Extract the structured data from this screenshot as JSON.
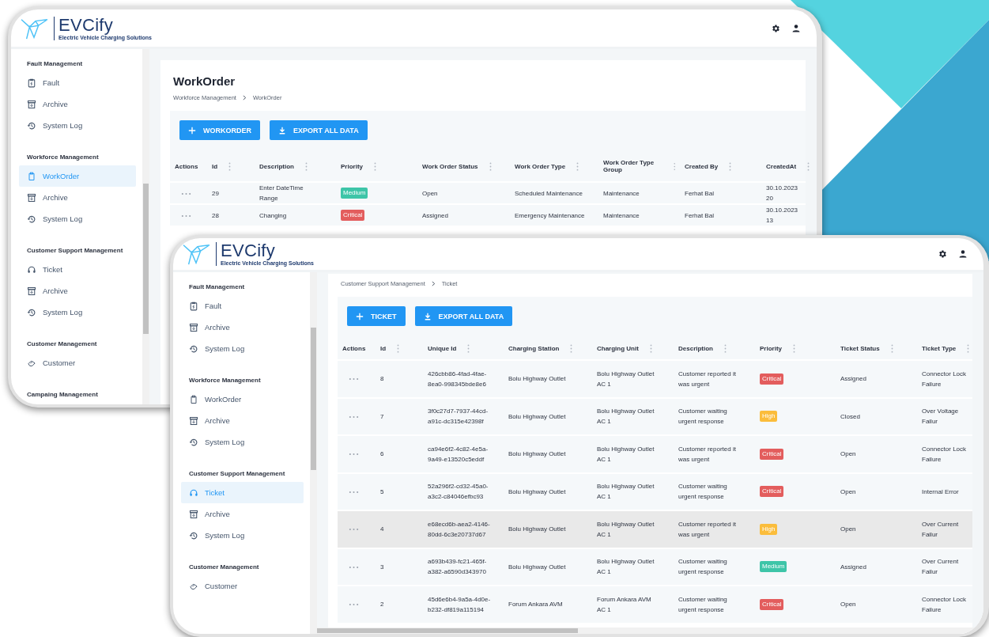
{
  "windows": [
    {
      "logo": {
        "name": "EVCify",
        "tagline": "Electric Vehicle Charging Solutions"
      },
      "sidebar": {
        "sections": [
          {
            "heading": "Fault Management",
            "items": [
              {
                "label": "Fault",
                "kind": "fault",
                "selected": false
              },
              {
                "label": "Archive",
                "kind": "archive",
                "selected": false
              },
              {
                "label": "System Log",
                "kind": "log",
                "selected": false
              }
            ]
          },
          {
            "heading": "Workforce Management",
            "items": [
              {
                "label": "WorkOrder",
                "kind": "workorder",
                "selected": true
              },
              {
                "label": "Archive",
                "kind": "archive",
                "selected": false
              },
              {
                "label": "System Log",
                "kind": "log",
                "selected": false
              }
            ]
          },
          {
            "heading": "Customer Support Management",
            "items": [
              {
                "label": "Ticket",
                "kind": "ticket",
                "selected": false
              },
              {
                "label": "Archive",
                "kind": "archive",
                "selected": false
              },
              {
                "label": "System Log",
                "kind": "log",
                "selected": false
              }
            ]
          },
          {
            "heading": "Customer Management",
            "items": [
              {
                "label": "Customer",
                "kind": "customer",
                "selected": false
              }
            ]
          },
          {
            "heading": "Campaing Management"
          }
        ]
      },
      "page_title": "WorkOrder",
      "breadcrumb": [
        "Workforce Management",
        "WorkOrder"
      ],
      "buttons": [
        {
          "label": "WORKORDER",
          "kind": "add"
        },
        {
          "label": "EXPORT ALL DATA",
          "kind": "export"
        }
      ],
      "table": {
        "columns": [
          {
            "label": "Actions",
            "kind": "actions"
          },
          {
            "label": "Id",
            "kind": "text"
          },
          {
            "label": "Description",
            "kind": "text"
          },
          {
            "label": "Priority",
            "kind": "badge"
          },
          {
            "label": "Work Order Status",
            "kind": "text"
          },
          {
            "label": "Work Order Type",
            "kind": "text"
          },
          {
            "label": "Work Order Type Group",
            "kind": "text"
          },
          {
            "label": "Created By",
            "kind": "text"
          },
          {
            "label": "CreatedAt",
            "kind": "text"
          }
        ],
        "rows": [
          {
            "selected": false,
            "cells": [
              "",
              "29",
              "Enter DateTime Range",
              {
                "label": "Medium",
                "color": "#3ec5a8"
              },
              "Open",
              "Scheduled Maintenance",
              "Maintenance",
              "Ferhat Bal",
              "30.10.2023 20"
            ]
          },
          {
            "selected": false,
            "cells": [
              "",
              "28",
              "Changing",
              {
                "label": "Critical",
                "color": "#e35d5d"
              },
              "Assigned",
              "Emergency Maintenance",
              "Maintenance",
              "Ferhat Bal",
              "30.10.2023 13"
            ]
          }
        ]
      }
    },
    {
      "logo": {
        "name": "EVCify",
        "tagline": "Electric Vehicle Charging Solutions"
      },
      "sidebar": {
        "sections": [
          {
            "heading": "Fault Management",
            "items": [
              {
                "label": "Fault",
                "kind": "fault",
                "selected": false
              },
              {
                "label": "Archive",
                "kind": "archive",
                "selected": false
              },
              {
                "label": "System Log",
                "kind": "log",
                "selected": false
              }
            ]
          },
          {
            "heading": "Workforce Management",
            "items": [
              {
                "label": "WorkOrder",
                "kind": "workorder",
                "selected": false
              },
              {
                "label": "Archive",
                "kind": "archive",
                "selected": false
              },
              {
                "label": "System Log",
                "kind": "log",
                "selected": false
              }
            ]
          },
          {
            "heading": "Customer Support Management",
            "items": [
              {
                "label": "Ticket",
                "kind": "ticket",
                "selected": true
              },
              {
                "label": "Archive",
                "kind": "archive",
                "selected": false
              },
              {
                "label": "System Log",
                "kind": "log",
                "selected": false
              }
            ]
          },
          {
            "heading": "Customer Management",
            "items": [
              {
                "label": "Customer",
                "kind": "customer",
                "selected": false
              }
            ]
          }
        ]
      },
      "breadcrumb": [
        "Customer Support Management",
        "Ticket"
      ],
      "buttons": [
        {
          "label": "TICKET",
          "kind": "add"
        },
        {
          "label": "EXPORT ALL DATA",
          "kind": "export"
        }
      ],
      "table": {
        "columns": [
          {
            "label": "Actions",
            "kind": "actions"
          },
          {
            "label": "Id",
            "kind": "text"
          },
          {
            "label": "Unique Id",
            "kind": "text"
          },
          {
            "label": "Charging Station",
            "kind": "text"
          },
          {
            "label": "Charging Unit",
            "kind": "text"
          },
          {
            "label": "Description",
            "kind": "text"
          },
          {
            "label": "Priority",
            "kind": "badge"
          },
          {
            "label": "Ticket Status",
            "kind": "text"
          },
          {
            "label": "Ticket Type",
            "kind": "text"
          }
        ],
        "rows": [
          {
            "selected": false,
            "cells": [
              "",
              "8",
              "426cbb86-4fad-4fae-8ea0-998345bde8e6",
              "Bolu Highway Outlet",
              "Bolu Highway Outlet AC 1",
              "Customer reported it was urgent",
              {
                "label": "Critical",
                "color": "#e35d5d"
              },
              "Assigned",
              "Connector Lock Failure"
            ]
          },
          {
            "selected": false,
            "cells": [
              "",
              "7",
              "3f0c27d7-7937-44cd-a91c-dc315e42398f",
              "Bolu Highway Outlet",
              "Bolu Highway Outlet AC 1",
              "Customer waiting urgent response",
              {
                "label": "High",
                "color": "#fbbd3c"
              },
              "Closed",
              "Over Voltage Failur"
            ]
          },
          {
            "selected": false,
            "cells": [
              "",
              "6",
              "ca94e6f2-4c82-4e5a-9a49-e13520c5eddf",
              "Bolu Highway Outlet",
              "Bolu Highway Outlet AC 1",
              "Customer reported it was urgent",
              {
                "label": "Critical",
                "color": "#e35d5d"
              },
              "Open",
              "Connector Lock Failure"
            ]
          },
          {
            "selected": false,
            "cells": [
              "",
              "5",
              "52a296f2-cd32-45a0-a3c2-c84046efbc93",
              "Bolu Highway Outlet",
              "Bolu Highway Outlet AC 1",
              "Customer waiting urgent response",
              {
                "label": "Critical",
                "color": "#e35d5d"
              },
              "Open",
              "Internal Error"
            ]
          },
          {
            "selected": true,
            "cells": [
              "",
              "4",
              "e68ecd6b-aea2-4146-80dd-6c3e20737d67",
              "Bolu Highway Outlet",
              "Bolu Highway Outlet AC 1",
              "Customer reported it was urgent",
              {
                "label": "High",
                "color": "#fbbd3c"
              },
              "Open",
              "Over Current Failur"
            ]
          },
          {
            "selected": false,
            "cells": [
              "",
              "3",
              "a693b439-fc21-465f-a382-a6590d343970",
              "Bolu Highway Outlet",
              "Bolu Highway Outlet AC 1",
              "Customer waiting urgent response",
              {
                "label": "Medium",
                "color": "#3ec5a8"
              },
              "Assigned",
              "Over Current Failur"
            ]
          },
          {
            "selected": false,
            "cells": [
              "",
              "2",
              "45d6e6b4-9a5a-4d0e-b232-df819a115194",
              "Forum Ankara AVM",
              "Forum Ankara AVM AC 1",
              "Customer waiting urgent response",
              {
                "label": "Critical",
                "color": "#e35d5d"
              },
              "Open",
              "Connector Lock Failure"
            ]
          }
        ]
      }
    }
  ]
}
